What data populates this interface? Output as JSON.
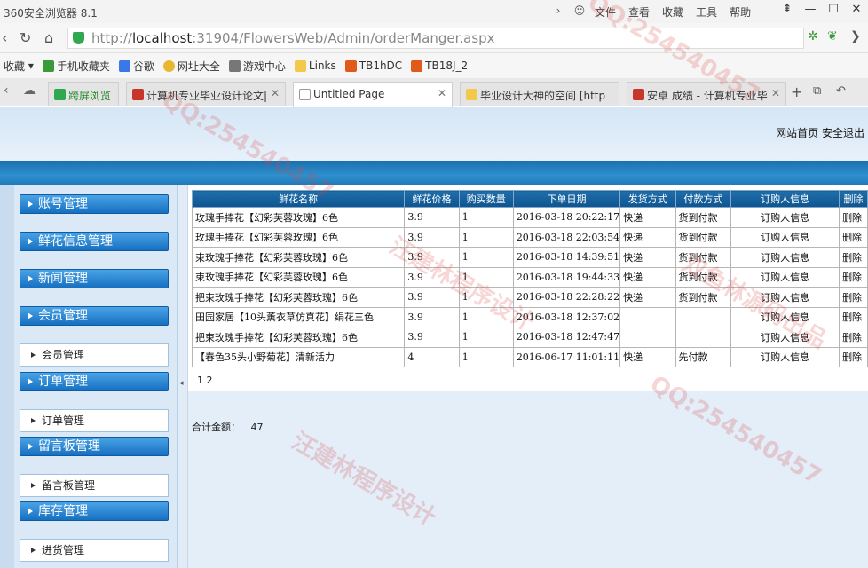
{
  "browser": {
    "app_title": "360安全浏览器 8.1",
    "menu": [
      "文件",
      "查看",
      "收藏",
      "工具",
      "帮助"
    ],
    "url_prefix": "http://",
    "url_host": "localhost",
    "url_rest": ":31904/FlowersWeb/Admin/orderManger.aspx",
    "favorites": [
      "收藏",
      "手机收藏夹",
      "谷歌",
      "网址大全",
      "游戏中心",
      "Links",
      "TB1hDC",
      "TB18J_2"
    ],
    "tabs": [
      {
        "label": "跨屏浏览"
      },
      {
        "label": "计算机专业毕业设计论文|"
      },
      {
        "label": "Untitled Page"
      },
      {
        "label": "毕业设计大神的空间 [http"
      },
      {
        "label": "安卓 成绩 - 计算机专业毕"
      }
    ]
  },
  "header": {
    "home_link": "网站首页",
    "logout_link": "安全退出"
  },
  "sidebar": {
    "sections": [
      {
        "title": "账号管理"
      },
      {
        "title": "鲜花信息管理"
      },
      {
        "title": "新闻管理"
      },
      {
        "title": "会员管理",
        "sub": "会员管理"
      },
      {
        "title": "订单管理",
        "sub": "订单管理"
      },
      {
        "title": "留言板管理",
        "sub": "留言板管理"
      },
      {
        "title": "库存管理",
        "sub": "进货管理"
      }
    ]
  },
  "orders": {
    "columns": [
      "鲜花名称",
      "鲜花价格",
      "购买数量",
      "下单日期",
      "发货方式",
      "付款方式",
      "订购人信息",
      "删除"
    ],
    "rows": [
      {
        "name": "玫瑰手捧花【幻彩芙蓉玫瑰】6色",
        "price": "3.9",
        "qty": "1",
        "date": "2016-03-18 20:22:17",
        "ship": "快递",
        "pay": "货到付款",
        "info": "订购人信息",
        "del": "删除"
      },
      {
        "name": "玫瑰手捧花【幻彩芙蓉玫瑰】6色",
        "price": "3.9",
        "qty": "1",
        "date": "2016-03-18 22:03:54",
        "ship": "快递",
        "pay": "货到付款",
        "info": "订购人信息",
        "del": "删除"
      },
      {
        "name": "束玫瑰手捧花【幻彩芙蓉玫瑰】6色",
        "price": "3.9",
        "qty": "1",
        "date": "2016-03-18 14:39:51",
        "ship": "快递",
        "pay": "货到付款",
        "info": "订购人信息",
        "del": "删除"
      },
      {
        "name": "束玫瑰手捧花【幻彩芙蓉玫瑰】6色",
        "price": "3.9",
        "qty": "1",
        "date": "2016-03-18 19:44:33",
        "ship": "快递",
        "pay": "货到付款",
        "info": "订购人信息",
        "del": "删除"
      },
      {
        "name": "把束玫瑰手捧花【幻彩芙蓉玫瑰】6色",
        "price": "3.9",
        "qty": "1",
        "date": "2016-03-18 22:28:22",
        "ship": "快递",
        "pay": "货到付款",
        "info": "订购人信息",
        "del": "删除"
      },
      {
        "name": "田园家居【10头薰衣草仿真花】绢花三色",
        "price": "3.9",
        "qty": "1",
        "date": "2016-03-18 12:37:02",
        "ship": "",
        "pay": "",
        "info": "订购人信息",
        "del": "删除"
      },
      {
        "name": "把束玫瑰手捧花【幻彩芙蓉玫瑰】6色",
        "price": "3.9",
        "qty": "1",
        "date": "2016-03-18 12:47:47",
        "ship": "",
        "pay": "",
        "info": "订购人信息",
        "del": "删除"
      },
      {
        "name": "【春色35头小野菊花】清新活力",
        "price": "4",
        "qty": "1",
        "date": "2016-06-17 11:01:11",
        "ship": "快递",
        "pay": "先付款",
        "info": "订购人信息",
        "del": "删除"
      }
    ],
    "pager": "1 2",
    "total_label": "合计金额：",
    "total_value": "47"
  },
  "watermarks": [
    "QQ:254540457",
    "汪建林程序设计",
    "双鱼林源码出品"
  ]
}
